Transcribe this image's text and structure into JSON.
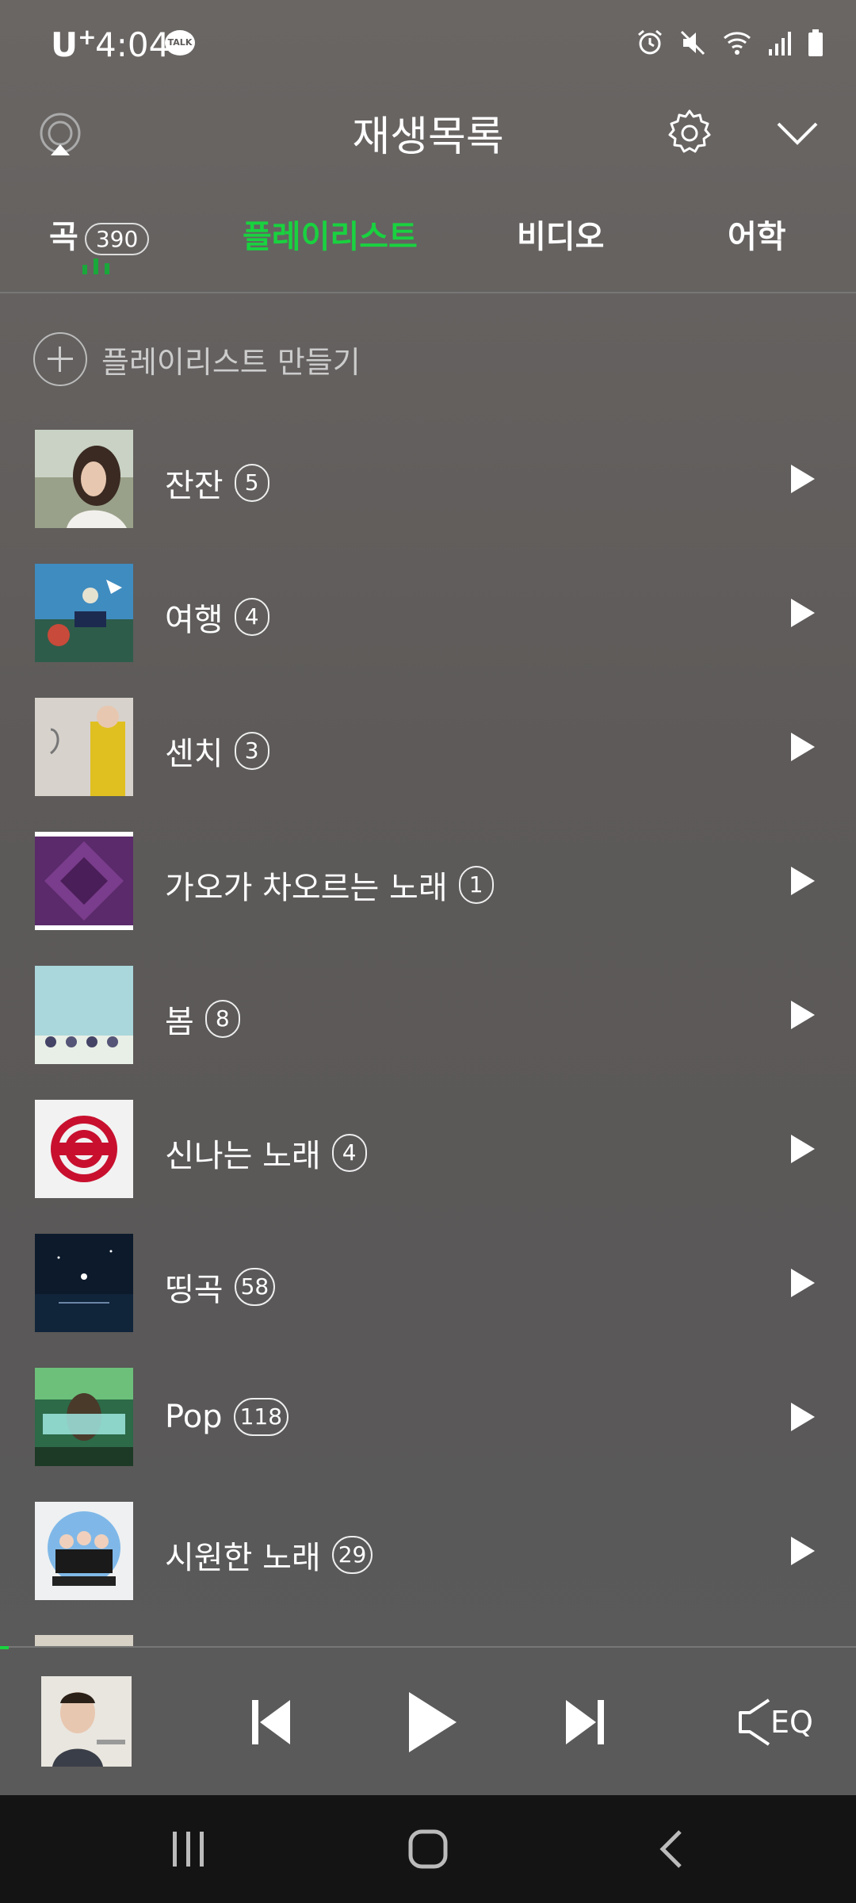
{
  "status_bar": {
    "carrier": "U",
    "carrier_sup": "+",
    "time": "4:04",
    "talk_label": "TALK"
  },
  "header": {
    "title": "재생목록"
  },
  "tabs": [
    {
      "label": "곡",
      "count": "390"
    },
    {
      "label": "플레이리스트"
    },
    {
      "label": "비디오"
    },
    {
      "label": "어학"
    }
  ],
  "create_playlist": {
    "label": "플레이리스트 만들기"
  },
  "playlists": [
    {
      "name": "잔잔",
      "count": "5"
    },
    {
      "name": "여행",
      "count": "4"
    },
    {
      "name": "센치",
      "count": "3"
    },
    {
      "name": "가오가 차오르는 노래",
      "count": "1"
    },
    {
      "name": "봄",
      "count": "8"
    },
    {
      "name": "신나는 노래",
      "count": "4"
    },
    {
      "name": "띵곡",
      "count": "58"
    },
    {
      "name": "Pop",
      "count": "118"
    },
    {
      "name": "시원한 노래",
      "count": "29"
    }
  ],
  "player": {
    "eq_label": "EQ",
    "progress": 0.01
  },
  "colors": {
    "accent": "#19d23f",
    "background": "#5d5a59",
    "nav_bar": "#141414"
  }
}
